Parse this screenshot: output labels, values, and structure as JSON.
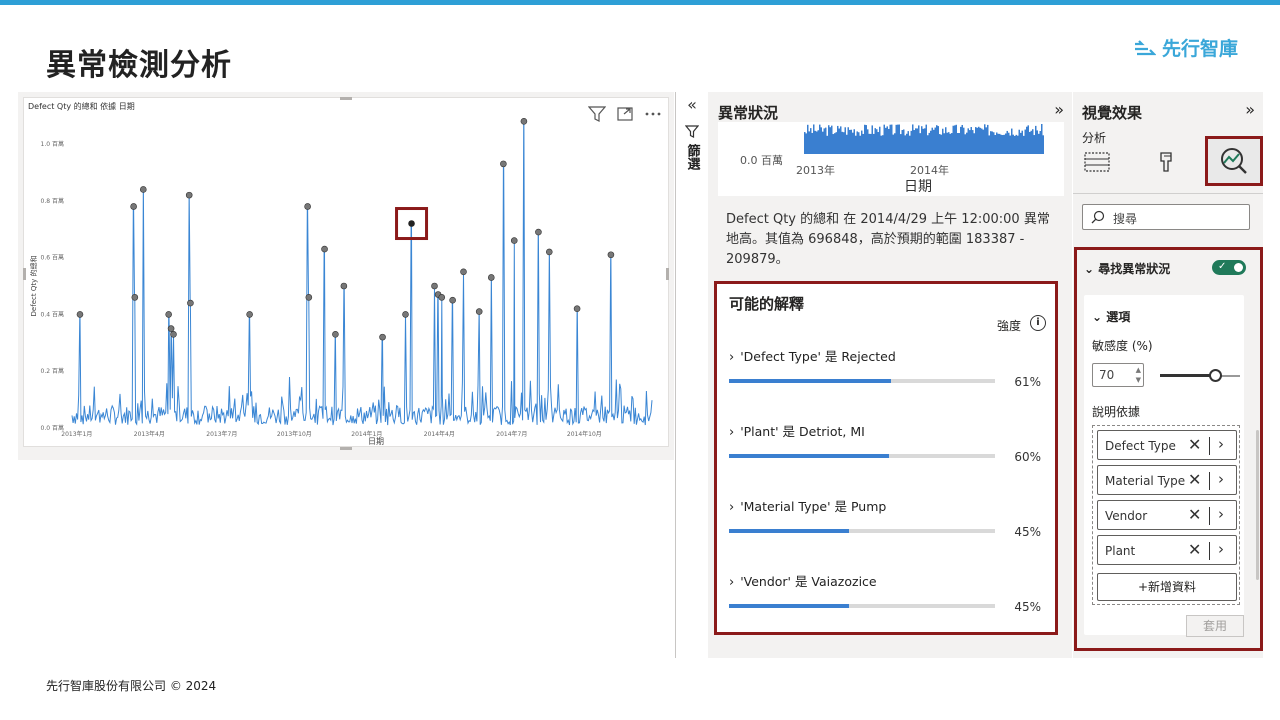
{
  "slide": {
    "title": "異常檢測分析",
    "logo_text": "先行智庫",
    "footer": "先行智庫股份有限公司 © 2024"
  },
  "colors": {
    "accent_bar": "#2e9fd6",
    "line": "#3a86d4",
    "highlight_border": "#8b1a1a",
    "toggle_on": "#207a5a"
  },
  "chart_visual": {
    "title": "Defect Qty 的總和 依據 日期",
    "actions": [
      "filter-icon",
      "focus-mode-icon",
      "more-options-icon"
    ]
  },
  "chart_data": {
    "type": "line",
    "title": "Defect Qty 的總和 依據 日期",
    "xlabel": "日期",
    "ylabel": "Defect Qty 的總和",
    "yticks": [
      "0.0 百萬",
      "0.2 百萬",
      "0.4 百萬",
      "0.6 百萬",
      "0.8 百萬",
      "1.0 百萬"
    ],
    "ylim": [
      0,
      1.0
    ],
    "xticks": [
      "2013年1月",
      "2013年4月",
      "2013年7月",
      "2013年10月",
      "2014年1月",
      "2014年4月",
      "2014年7月",
      "2014年10月"
    ],
    "xlim": [
      0,
      24
    ],
    "grid": false,
    "anomaly_points": [
      {
        "x": 0.33,
        "y": 0.4
      },
      {
        "x": 2.55,
        "y": 0.78
      },
      {
        "x": 2.6,
        "y": 0.46
      },
      {
        "x": 2.95,
        "y": 0.84
      },
      {
        "x": 4.0,
        "y": 0.4
      },
      {
        "x": 4.1,
        "y": 0.35
      },
      {
        "x": 4.2,
        "y": 0.33
      },
      {
        "x": 4.85,
        "y": 0.82
      },
      {
        "x": 4.9,
        "y": 0.44
      },
      {
        "x": 7.35,
        "y": 0.4
      },
      {
        "x": 9.75,
        "y": 0.78
      },
      {
        "x": 9.8,
        "y": 0.46
      },
      {
        "x": 10.45,
        "y": 0.63
      },
      {
        "x": 10.9,
        "y": 0.33
      },
      {
        "x": 11.25,
        "y": 0.5
      },
      {
        "x": 12.85,
        "y": 0.32
      },
      {
        "x": 13.8,
        "y": 0.4
      },
      {
        "x": 14.05,
        "y": 0.72
      },
      {
        "x": 15.0,
        "y": 0.5
      },
      {
        "x": 15.15,
        "y": 0.47
      },
      {
        "x": 15.3,
        "y": 0.46
      },
      {
        "x": 15.75,
        "y": 0.45
      },
      {
        "x": 16.2,
        "y": 0.55
      },
      {
        "x": 16.85,
        "y": 0.41
      },
      {
        "x": 17.35,
        "y": 0.53
      },
      {
        "x": 17.85,
        "y": 0.93
      },
      {
        "x": 18.3,
        "y": 0.66
      },
      {
        "x": 18.7,
        "y": 1.08
      },
      {
        "x": 19.3,
        "y": 0.69
      },
      {
        "x": 19.75,
        "y": 0.62
      },
      {
        "x": 20.9,
        "y": 0.42
      },
      {
        "x": 22.3,
        "y": 0.61
      }
    ],
    "selected_point": {
      "x": 14.05,
      "y": 0.72
    }
  },
  "filters_strip": {
    "label": "篩選"
  },
  "anomaly_pane": {
    "title": "異常狀況",
    "mini_chart": {
      "y_zero": "0.0 百萬",
      "x_ticks": [
        "2013年",
        "2014年"
      ],
      "x_label": "日期"
    },
    "description": "Defect Qty 的總和 在 2014/4/29 上午 12:00:00 異常地高。其值為 696848，高於預期的範圍 183387 - 209879。",
    "explanations": {
      "title": "可能的解釋",
      "strength_label": "強度",
      "items": [
        {
          "label": "'Defect Type' 是 Rejected",
          "percent_text": "61%",
          "value": 0.61
        },
        {
          "label": "'Plant' 是 Detriot, MI",
          "percent_text": "60%",
          "value": 0.6
        },
        {
          "label": "'Material Type' 是 Pump",
          "percent_text": "45%",
          "value": 0.45
        },
        {
          "label": "'Vendor' 是 Vaiazozice",
          "percent_text": "45%",
          "value": 0.45
        }
      ]
    }
  },
  "visual_pane": {
    "title": "視覺效果",
    "subtitle": "分析",
    "search_placeholder": "搜尋",
    "find_anomalies": {
      "title": "尋找異常狀況",
      "enabled": true,
      "options_title": "選項",
      "sensitivity_label": "敏感度 (%)",
      "sensitivity_value": "70",
      "sensitivity": 0.7,
      "explain_by_label": "說明依據",
      "fields": [
        "Defect Type",
        "Material Type",
        "Vendor",
        "Plant"
      ],
      "add_data_label": "+新增資料",
      "apply_label": "套用"
    }
  }
}
